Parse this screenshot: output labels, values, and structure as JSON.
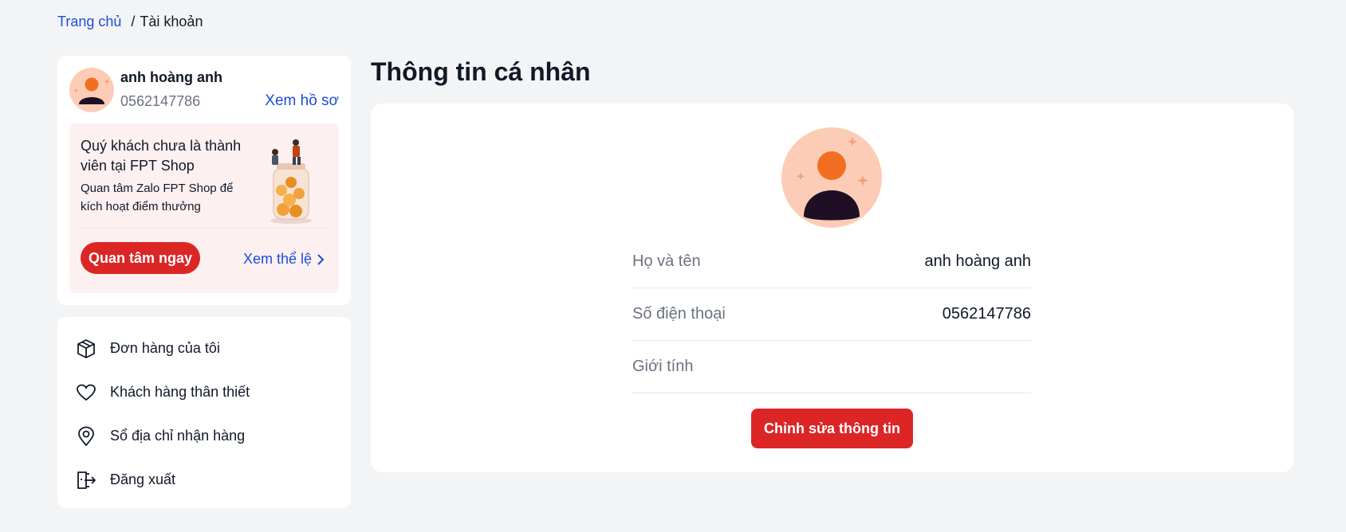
{
  "breadcrumb": {
    "home": "Trang chủ",
    "separator": "/",
    "current": "Tài khoản"
  },
  "profile": {
    "name": "anh hoàng anh",
    "phone": "0562147786",
    "view_profile": "Xem hồ sơ"
  },
  "promo": {
    "title": "Quý khách chưa là thành viên tại FPT Shop",
    "subtitle": "Quan tâm Zalo FPT Shop để kích hoạt điểm thưởng",
    "follow_button": "Quan tâm ngay",
    "rules_link": "Xem thể lệ"
  },
  "menu": {
    "items": [
      {
        "label": "Đơn hàng của tôi",
        "icon": "box-icon"
      },
      {
        "label": "Khách hàng thân thiết",
        "icon": "heart-icon"
      },
      {
        "label": "Sổ địa chỉ nhận hàng",
        "icon": "location-pin-icon"
      },
      {
        "label": "Đăng xuất",
        "icon": "logout-icon"
      }
    ]
  },
  "main": {
    "title": "Thông tin cá nhân",
    "fields": [
      {
        "label": "Họ và tên",
        "value": "anh hoàng anh"
      },
      {
        "label": "Số điện thoại",
        "value": "0562147786"
      },
      {
        "label": "Giới tính",
        "value": ""
      }
    ],
    "edit_button": "Chỉnh sửa thông tin"
  },
  "colors": {
    "accent_red": "#dc2626",
    "link_blue": "#1d4ed8",
    "avatar_bg": "#fdccb6",
    "avatar_head": "#f26f22",
    "avatar_body": "#1f0f24",
    "promo_bg": "#fdf0f0"
  }
}
